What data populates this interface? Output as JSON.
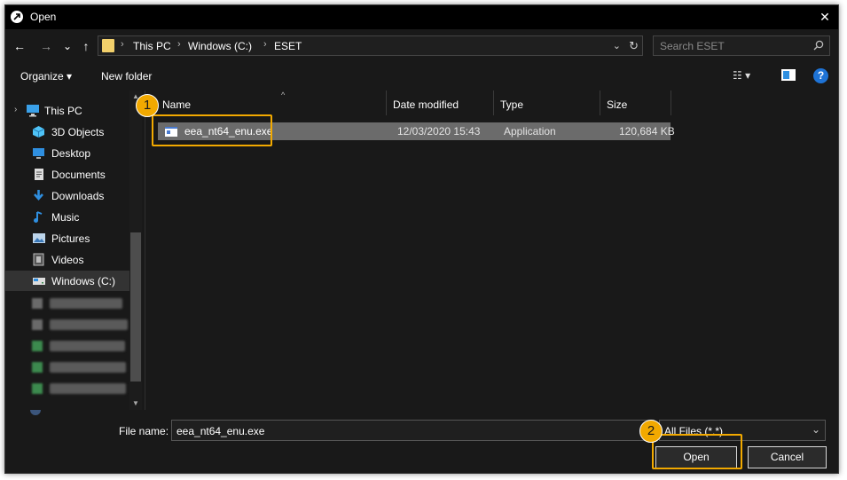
{
  "window": {
    "title": "Open",
    "close_glyph": "✕"
  },
  "nav": {
    "back_glyph": "←",
    "forward_glyph": "→",
    "recent_glyph": "⌄",
    "up_glyph": "↑",
    "breadcrumbs": [
      "This PC",
      "Windows (C:)",
      "ESET"
    ],
    "separator": "›",
    "address_dropdown_glyph": "⌄",
    "refresh_glyph": "↻",
    "search_placeholder": "Search ESET"
  },
  "toolbar": {
    "organize_label": "Organize ▾",
    "new_folder_label": "New folder",
    "view_glyph": "☷ ▾",
    "help_glyph": "?"
  },
  "sidebar": {
    "items": [
      {
        "label": "This PC",
        "icon": "computer-icon",
        "color": "#3aa0e8"
      },
      {
        "label": "3D Objects",
        "icon": "cube-icon",
        "color": "#4fc3f7"
      },
      {
        "label": "Desktop",
        "icon": "desktop-icon",
        "color": "#2f8fe0"
      },
      {
        "label": "Documents",
        "icon": "document-icon",
        "color": "#dddddd"
      },
      {
        "label": "Downloads",
        "icon": "download-icon",
        "color": "#2f8fe0"
      },
      {
        "label": "Music",
        "icon": "music-icon",
        "color": "#2f8fe0"
      },
      {
        "label": "Pictures",
        "icon": "pictures-icon",
        "color": "#bcd4ea"
      },
      {
        "label": "Videos",
        "icon": "videos-icon",
        "color": "#bbbbbb"
      },
      {
        "label": "Windows  (C:)",
        "icon": "drive-icon",
        "color": "#dddddd",
        "selected": true
      }
    ]
  },
  "file_list": {
    "columns": [
      "Name",
      "Date modified",
      "Type",
      "Size"
    ],
    "sort_glyph": "^",
    "rows": [
      {
        "name": "eea_nt64_enu.exe",
        "date_modified": "12/03/2020 15:43",
        "type": "Application",
        "size": "120,684 KB",
        "selected": true
      }
    ]
  },
  "footer": {
    "file_name_label": "File name:",
    "file_name_value": "eea_nt64_enu.exe",
    "filter_value": "All Files (*.*)",
    "filter_chevron": "⌄",
    "open_label": "Open",
    "cancel_label": "Cancel"
  },
  "callouts": [
    {
      "number": "1",
      "target": "file row eea_nt64_enu.exe"
    },
    {
      "number": "2",
      "target": "Open button"
    }
  ],
  "colors": {
    "accent_callout": "#f2a900",
    "background": "#191919",
    "selection": "#6b6b6b",
    "help": "#1e73d6"
  }
}
